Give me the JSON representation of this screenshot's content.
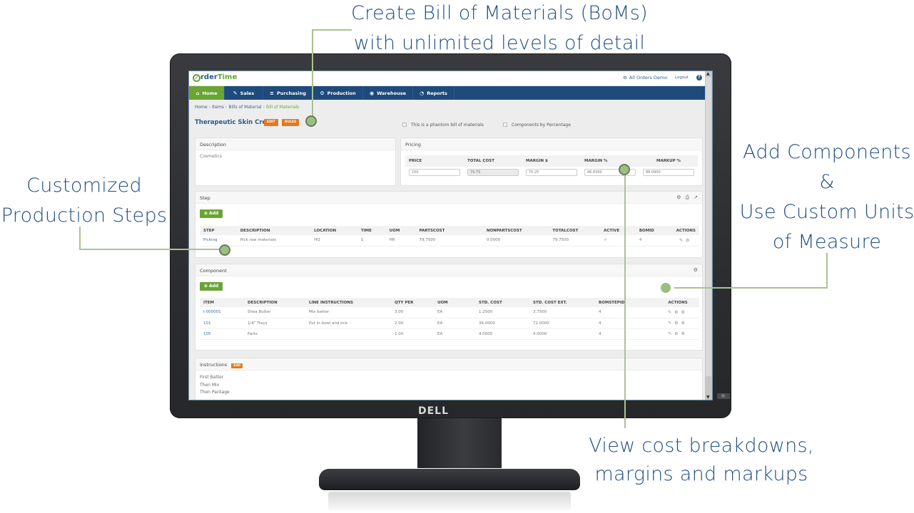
{
  "callouts": {
    "top": [
      "Create Bill of Materials (BoMs)",
      "with unlimited levels of detail"
    ],
    "left": [
      "Customized",
      "Production Steps"
    ],
    "right": [
      "Add Components",
      "&",
      "Use Custom Units",
      "of Measure"
    ],
    "bottom": [
      "View cost breakdowns,",
      "margins and markups"
    ]
  },
  "monitor": {
    "brand": "DELL"
  },
  "app": {
    "logo": {
      "o": "O",
      "rder": "rder",
      "time": "Time"
    },
    "company": "All Orders Demo",
    "logout": "Logout",
    "help": "?",
    "nav": [
      {
        "label": "Home",
        "icon": "⌂",
        "active": true
      },
      {
        "label": "Sales",
        "icon": "✎",
        "active": false
      },
      {
        "label": "Purchasing",
        "icon": "🛒",
        "active": false
      },
      {
        "label": "Production",
        "icon": "⚙",
        "active": false
      },
      {
        "label": "Warehouse",
        "icon": "◉",
        "active": false
      },
      {
        "label": "Reports",
        "icon": "◔",
        "active": false
      }
    ],
    "breadcrumb": [
      "Home",
      "Items",
      "Bills of Material",
      "Bill of Materials"
    ],
    "title": "Therapeutic Skin Cream",
    "edit_badge": "EDIT",
    "rules_badge": "RULES",
    "phantom_checkbox": "This is a phantom bill of materials",
    "percentage_checkbox": "Components by Percentage",
    "description": {
      "heading": "Description",
      "value": "Cosmetics"
    },
    "pricing": {
      "heading": "Pricing",
      "columns": [
        "PRICE",
        "TOTAL COST",
        "MARGIN $",
        "MARGIN %",
        "MARKUP %"
      ],
      "values": [
        "150",
        "79.75",
        "70.25",
        "46.8300",
        "88.0900"
      ]
    },
    "step": {
      "heading": "Step",
      "add_label": "Add",
      "columns": [
        "STEP",
        "DESCRIPTION",
        "LOCATION",
        "TIME",
        "UOM",
        "PARTSCOST",
        "NONPARTSCOST",
        "TOTALCOST",
        "ACTIVE",
        "BOMID",
        "ACTIONS"
      ],
      "rows": [
        {
          "step": "Picking",
          "description": "Pick raw materials",
          "location": "HQ",
          "time": "1",
          "uom": "HR",
          "partscost": "79.7500",
          "nonpartscost": "0.0000",
          "totalcost": "79.7500",
          "active": "✔",
          "bomid": "4"
        }
      ]
    },
    "component": {
      "heading": "Component",
      "add_label": "Add",
      "columns": [
        "ITEM",
        "DESCRIPTION",
        "LINE INSTRUCTIONS",
        "QTY PER",
        "UOM",
        "STD. COST",
        "STD. COST EXT.",
        "BOMSTEPID",
        "ACTIONS"
      ],
      "rows": [
        {
          "item": "I-000001",
          "description": "Shea Butter",
          "instructions": "Mix batter",
          "qty": "3.00",
          "uom": "EA",
          "cost": "1.2500",
          "ext": "3.7500",
          "stepid": "4"
        },
        {
          "item": "101",
          "description": "1/4\" Trays",
          "instructions": "Put in bowl and mix",
          "qty": "2.00",
          "uom": "EA",
          "cost": "36.0000",
          "ext": "72.0000",
          "stepid": "4"
        },
        {
          "item": "105",
          "description": "Parts",
          "instructions": "",
          "qty": "1.00",
          "uom": "EA",
          "cost": "4.0000",
          "ext": "4.0000",
          "stepid": "4"
        }
      ]
    },
    "instructions": {
      "heading": "Instructions",
      "edit_badge": "Edit",
      "lines": [
        "First Batter",
        "Then Mix",
        "Then Package"
      ]
    }
  }
}
